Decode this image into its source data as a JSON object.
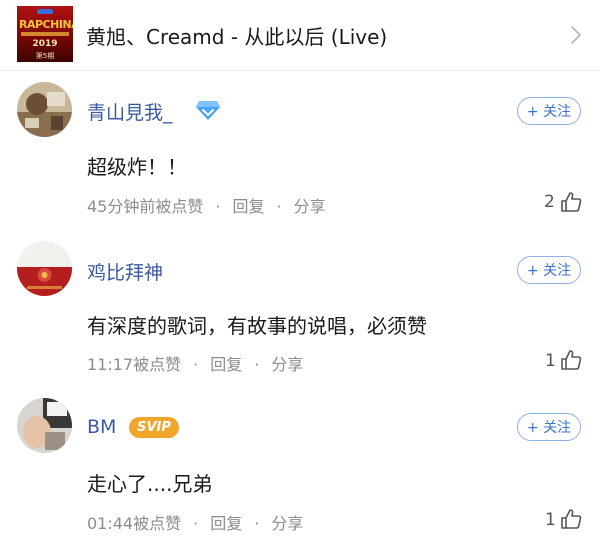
{
  "song": {
    "title": "黄旭、Creamd - 从此以后 (Live)",
    "album_art": {
      "logo_text": "RAPCHINA",
      "year": "2019",
      "label": "第5期"
    }
  },
  "comments": [
    {
      "username": "青山見我_",
      "badge": "diamond-icon",
      "follow_label": "+ 关注",
      "text": "超级炸！！",
      "time": "45分钟前被点赞",
      "reply_label": "回复",
      "share_label": "分享",
      "likes": "2"
    },
    {
      "username": "鸡比拜神",
      "follow_label": "+ 关注",
      "text": "有深度的歌词，有故事的说唱，必须赞",
      "time": "11:17被点赞",
      "reply_label": "回复",
      "share_label": "分享",
      "likes": "1"
    },
    {
      "username": "BM",
      "badge": "SVIP",
      "follow_label": "+ 关注",
      "text": "走心了....兄弟",
      "time": "01:44被点赞",
      "reply_label": "回复",
      "share_label": "分享",
      "likes": "1"
    }
  ],
  "colors": {
    "accent": "#3f73c8",
    "username": "#3b5aa3",
    "meta": "#8c8c8c",
    "svip": "#f0a62a"
  }
}
